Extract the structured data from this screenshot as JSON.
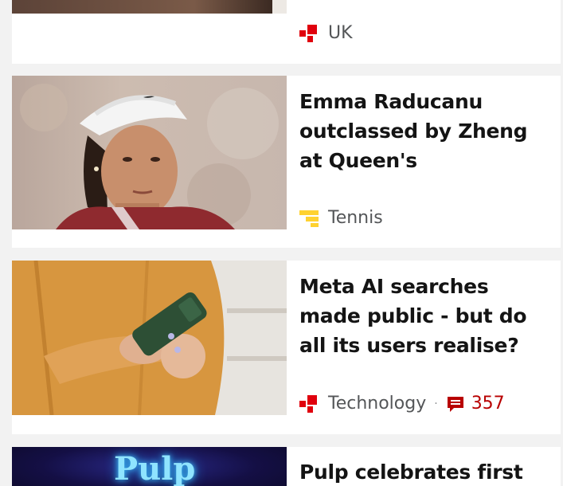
{
  "articles": [
    {
      "headline": "",
      "topic": "UK",
      "topic_icon": "news-mark-icon",
      "topic_color": "#e0000d"
    },
    {
      "headline": "Emma Raducanu outclassed by Zheng at Queen's",
      "topic": "Tennis",
      "topic_icon": "sport-mark-icon",
      "topic_color": "#ffd230"
    },
    {
      "headline": "Meta AI searches made public - but do all its users realise?",
      "topic": "Technology",
      "topic_icon": "news-mark-icon",
      "topic_color": "#e0000d",
      "separator": "·",
      "comments": "357",
      "comments_icon": "comment-icon",
      "comments_color": "#b80000"
    },
    {
      "headline": "Pulp celebrates first",
      "thumb_text": "Pulp"
    }
  ]
}
